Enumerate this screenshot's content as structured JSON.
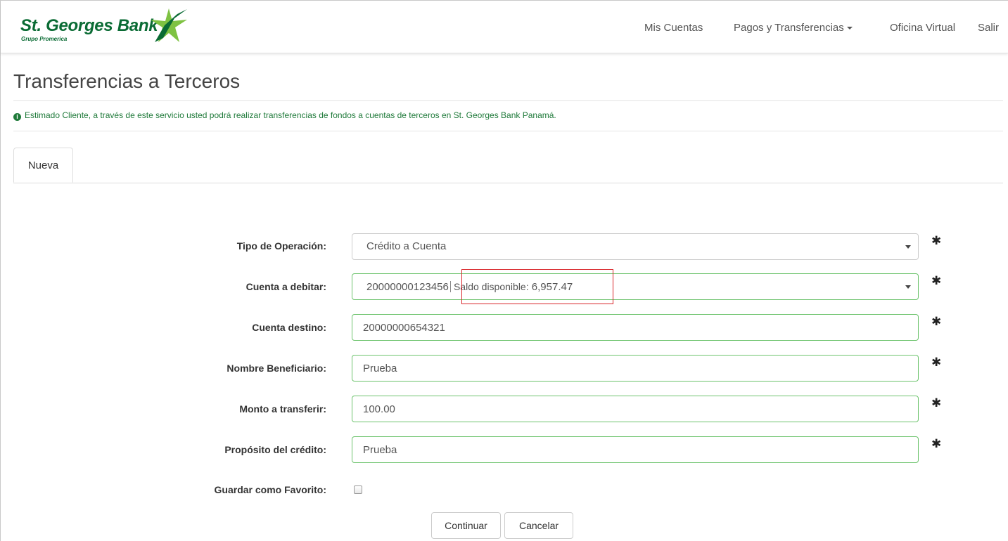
{
  "brand": {
    "name": "St. Georges Bank",
    "subtitle": "Grupo Promerica",
    "colors": {
      "primary": "#0a6b34",
      "star_light": "#7ec242",
      "info_green": "#1f7a3a",
      "valid_border": "#6cc36c",
      "highlight_red": "#d9252a"
    }
  },
  "nav": {
    "mis_cuentas": "Mis Cuentas",
    "pagos": "Pagos y Transferencias",
    "oficina": "Oficina Virtual",
    "salir": "Salir"
  },
  "page": {
    "title": "Transferencias a Terceros",
    "info": "Estimado Cliente, a través de este servicio usted podrá realizar transferencias de fondos a cuentas de terceros en St. Georges Bank Panamá.",
    "info_icon": "info-circle-icon"
  },
  "tabs": [
    {
      "label": "Nueva",
      "active": true
    }
  ],
  "form": {
    "tipo_operacion": {
      "label": "Tipo de Operación:",
      "value": "Crédito a Cuenta"
    },
    "cuenta_debitar": {
      "label": "Cuenta a debitar:",
      "account": "20000000123456",
      "saldo_label": "Saldo disponible:",
      "saldo_value": "6,957.47"
    },
    "cuenta_destino": {
      "label": "Cuenta destino:",
      "value": "20000000654321"
    },
    "nombre_beneficiario": {
      "label": "Nombre Beneficiario:",
      "value": "Prueba"
    },
    "monto": {
      "label": "Monto a transferir:",
      "value": "100.00"
    },
    "proposito": {
      "label": "Propósito del crédito:",
      "value": "Prueba"
    },
    "favorito": {
      "label": "Guardar como Favorito:",
      "checked": false
    },
    "required_mark": "✱"
  },
  "buttons": {
    "continuar": "Continuar",
    "cancelar": "Cancelar"
  }
}
